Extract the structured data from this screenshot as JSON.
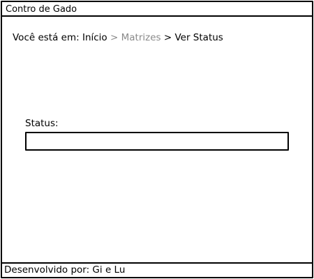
{
  "window": {
    "title": "Contro de Gado"
  },
  "breadcrumb": {
    "prefix": "Você está em:",
    "items": [
      {
        "label": "Início"
      },
      {
        "label": "Matrizes"
      },
      {
        "label": "Ver Status"
      }
    ],
    "separator": ">"
  },
  "form": {
    "status_label": "Status:",
    "status_value": ""
  },
  "footer": {
    "text": "Desenvolvido por: Gi e Lu"
  },
  "colors": {
    "border": "#000000",
    "muted_link": "#8a8a8a",
    "background": "#ffffff"
  }
}
